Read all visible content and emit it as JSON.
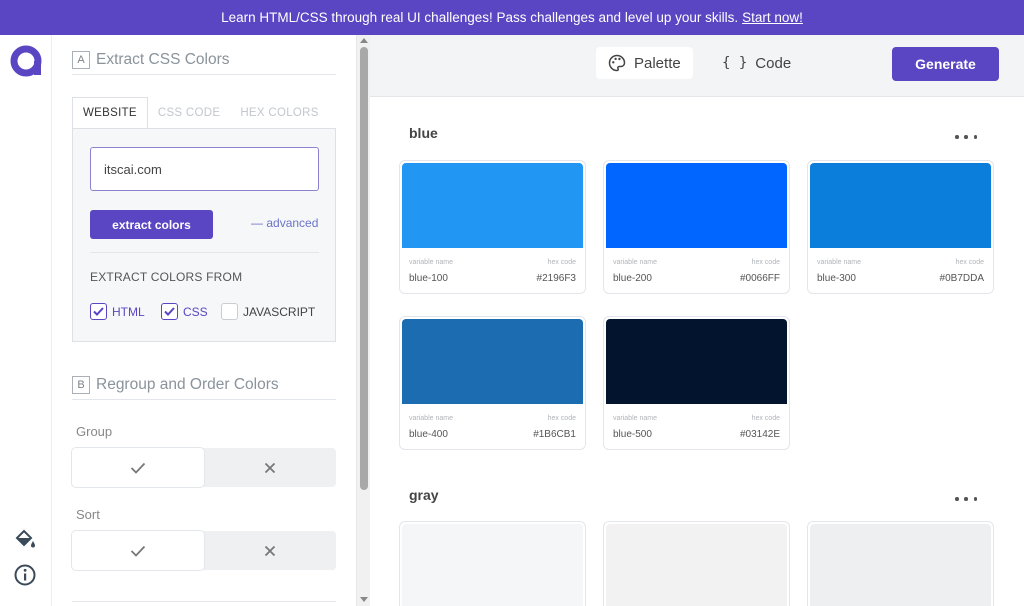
{
  "banner": {
    "text": "Learn HTML/CSS through real UI challenges! Pass challenges and level up your skills.",
    "link": "Start now!"
  },
  "colors": {
    "accent": "#5a45c2"
  },
  "rail": {
    "icons": [
      "paint-bucket-icon",
      "info-icon"
    ]
  },
  "sections": {
    "extract": {
      "letter": "A",
      "title": "Extract CSS Colors"
    },
    "regroup": {
      "letter": "B",
      "title": "Regroup and Order Colors"
    }
  },
  "tabs": [
    "WEBSITE",
    "CSS CODE",
    "HEX COLORS"
  ],
  "website": {
    "value": "itscai.com",
    "extract_label": "extract colors",
    "advanced_label": "advanced",
    "from_label": "EXTRACT COLORS FROM",
    "checks": [
      {
        "label": "HTML",
        "checked": true
      },
      {
        "label": "CSS",
        "checked": true
      },
      {
        "label": "JAVASCRIPT",
        "checked": false
      }
    ]
  },
  "group": {
    "label": "Group",
    "selected": "check"
  },
  "sort": {
    "label": "Sort",
    "selected": "check"
  },
  "view_tabs": {
    "palette": "Palette",
    "code": "Code",
    "active": "Palette"
  },
  "generate_label": "Generate",
  "palette": {
    "meta_name": "variable name",
    "meta_code": "hex code",
    "groups": [
      {
        "name": "blue",
        "colors": [
          {
            "name": "blue-100",
            "hex": "#2196F3"
          },
          {
            "name": "blue-200",
            "hex": "#0066FF"
          },
          {
            "name": "blue-300",
            "hex": "#0B7DDA"
          },
          {
            "name": "blue-400",
            "hex": "#1B6CB1"
          },
          {
            "name": "blue-500",
            "hex": "#03142E"
          }
        ]
      },
      {
        "name": "gray",
        "colors": [
          {
            "swatch": "#f5f6f7"
          },
          {
            "swatch": "#f2f2f3"
          },
          {
            "swatch": "#eeeff0"
          }
        ]
      }
    ]
  }
}
